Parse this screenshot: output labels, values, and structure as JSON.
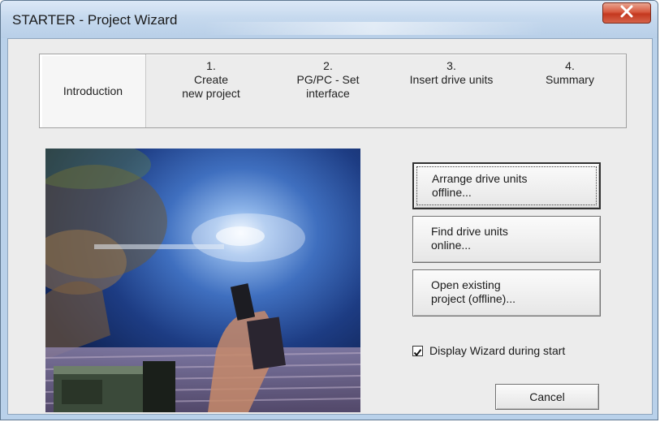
{
  "window": {
    "title": "STARTER - Project Wizard"
  },
  "steps": [
    {
      "number": "",
      "label_line1": "Introduction",
      "label_line2": ""
    },
    {
      "number": "1.",
      "label_line1": "Create",
      "label_line2": "new project"
    },
    {
      "number": "2.",
      "label_line1": "PG/PC - Set",
      "label_line2": "interface"
    },
    {
      "number": "3.",
      "label_line1": "Insert drive units",
      "label_line2": ""
    },
    {
      "number": "4.",
      "label_line1": "Summary",
      "label_line2": ""
    }
  ],
  "actions": {
    "arrange_offline": {
      "line1": "Arrange drive units",
      "line2": "offline..."
    },
    "find_online": {
      "line1": "Find drive units",
      "line2": "online..."
    },
    "open_existing": {
      "line1": "Open existing",
      "line2": "project (offline)..."
    }
  },
  "display_wizard": {
    "label": "Display Wizard during start",
    "checked": true
  },
  "cancel_label": "Cancel",
  "icons": {
    "close": "close-icon",
    "checkmark": "checkmark-icon"
  },
  "colors": {
    "close_button": "#d7593f",
    "title_bar": "#c6d9ee",
    "dialog_bg": "#ececec"
  }
}
